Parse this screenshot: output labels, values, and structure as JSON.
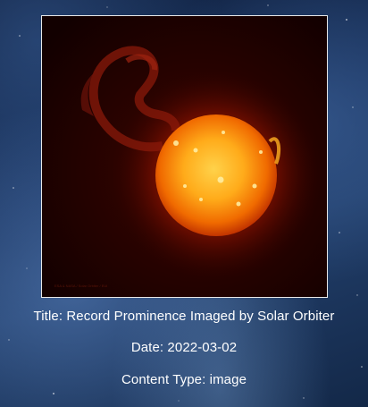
{
  "photo": {
    "icon": "sun-prominence-image"
  },
  "details": {
    "title": "Title: Record Prominence Imaged by Solar Orbiter",
    "date": "Date: 2022-03-02",
    "content_type": "Content Type: image"
  },
  "colors": {
    "text": "#ffffff",
    "frame_border": "#e8e8e8",
    "photo_background": "#170000"
  }
}
